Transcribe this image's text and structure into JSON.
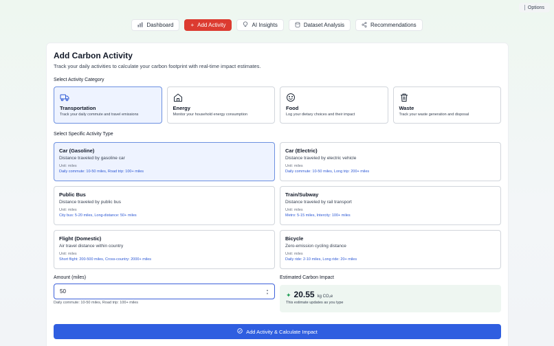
{
  "options": {
    "label": "Options"
  },
  "nav": {
    "tabs": [
      {
        "label": "Dashboard",
        "icon": "bar-chart-icon"
      },
      {
        "label": "Add Activity",
        "icon": "plus-icon",
        "active": true
      },
      {
        "label": "AI Insights",
        "icon": "lightbulb-icon"
      },
      {
        "label": "Dataset Analysis",
        "icon": "database-icon"
      },
      {
        "label": "Recommendations",
        "icon": "share-icon"
      }
    ]
  },
  "page": {
    "title": "Add Carbon Activity",
    "subtitle": "Track your daily activities to calculate your carbon footprint with real-time impact estimates.",
    "category_label": "Select Activity Category",
    "activity_label": "Select Specific Activity Type"
  },
  "categories": [
    {
      "title": "Transportation",
      "desc": "Track your daily commute and travel emissions",
      "icon": "truck-icon",
      "selected": true
    },
    {
      "title": "Energy",
      "desc": "Monitor your household energy consumption",
      "icon": "home-icon"
    },
    {
      "title": "Food",
      "desc": "Log your dietary choices and their impact",
      "icon": "smile-icon"
    },
    {
      "title": "Waste",
      "desc": "Track your waste generation and disposal",
      "icon": "trash-icon"
    }
  ],
  "activities": [
    {
      "title": "Car (Gasoline)",
      "desc": "Distance traveled by gasoline car",
      "unit": "Unit: miles",
      "example": "Daily commute: 10-50 miles, Road trip: 100+ miles",
      "selected": true
    },
    {
      "title": "Car (Electric)",
      "desc": "Distance traveled by electric vehicle",
      "unit": "Unit: miles",
      "example": "Daily commute: 10-50 miles, Long trip: 200+ miles"
    },
    {
      "title": "Public Bus",
      "desc": "Distance traveled by public bus",
      "unit": "Unit: miles",
      "example": "City bus: 5-20 miles, Long-distance: 50+ miles"
    },
    {
      "title": "Train/Subway",
      "desc": "Distance traveled by rail transport",
      "unit": "Unit: miles",
      "example": "Metro: 5-15 miles, Intercity: 100+ miles"
    },
    {
      "title": "Flight (Domestic)",
      "desc": "Air travel distance within country",
      "unit": "Unit: miles",
      "example": "Short flight: 200-500 miles, Cross-country: 2000+ miles"
    },
    {
      "title": "Bicycle",
      "desc": "Zero-emission cycling distance",
      "unit": "Unit: miles",
      "example": "Daily ride: 2-10 miles, Long ride: 20+ miles"
    }
  ],
  "amount": {
    "label": "Amount (miles)",
    "value": "50",
    "hint": "Daily commute: 10-50 miles, Road trip: 100+ miles"
  },
  "impact": {
    "label": "Estimated Carbon Impact",
    "value": "20.55",
    "unit": "kg CO₂e",
    "note": "This estimate updates as you type"
  },
  "submit": {
    "label": "Add Activity & Calculate Impact"
  }
}
